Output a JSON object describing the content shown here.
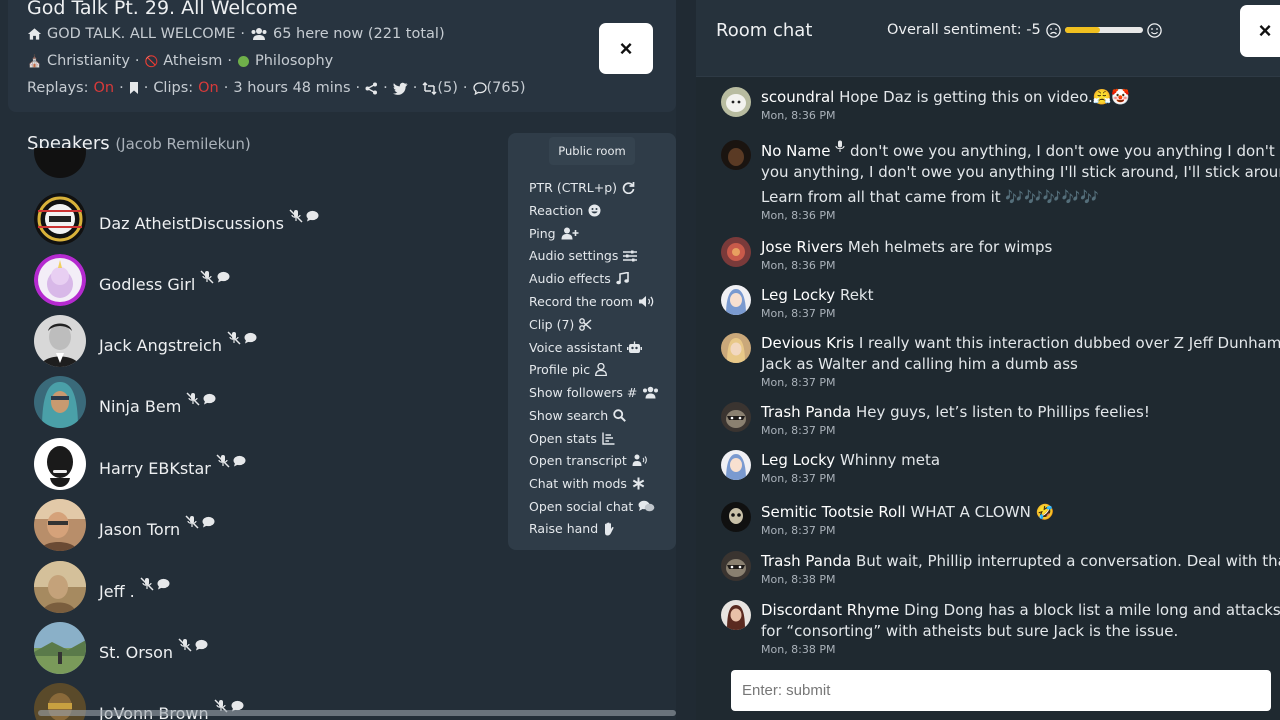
{
  "room": {
    "title": "God Talk Pt. 29. All Welcome",
    "subtitle": "GOD TALK. ALL WELCOME",
    "listeners": "65 here now (221 total)",
    "topics": [
      "Christianity",
      "Atheism",
      "Philosophy"
    ],
    "replays_label": "Replays:",
    "replays_value": "On",
    "clips_label": "Clips:",
    "clips_value": "On",
    "duration": "3 hours 48 mins",
    "reposts": "(5)",
    "comments": "(765)",
    "close_label": "×"
  },
  "speakers": {
    "title": "Speakers",
    "host": "(Jacob Remilekun)",
    "list": [
      {
        "name": "Daz AtheistDiscussions",
        "avatar": "atheist-logo-avatar"
      },
      {
        "name": "Godless Girl",
        "avatar": "unicorn-avatar"
      },
      {
        "name": "Jack Angstreich",
        "avatar": "portrait-avatar"
      },
      {
        "name": "Ninja Bem",
        "avatar": "hooded-avatar"
      },
      {
        "name": "Harry EBKstar",
        "avatar": "dark-face-avatar"
      },
      {
        "name": "Jason Torn",
        "avatar": "outdoor-avatar"
      },
      {
        "name": "Jeff .",
        "avatar": "sepia-avatar"
      },
      {
        "name": "St. Orson",
        "avatar": "landscape-avatar"
      },
      {
        "name": "JoVonn Brown",
        "avatar": "jovonn-avatar"
      }
    ]
  },
  "menu": {
    "public_room": "Public room",
    "items": [
      {
        "label": "PTR (CTRL+p)",
        "icon": "refresh-icon"
      },
      {
        "label": "Reaction",
        "icon": "smile-icon"
      },
      {
        "label": "Ping",
        "icon": "user-plus-icon"
      },
      {
        "label": "Audio settings",
        "icon": "sliders-icon"
      },
      {
        "label": "Audio effects",
        "icon": "music-icon"
      },
      {
        "label": "Record the room",
        "icon": "volume-icon"
      },
      {
        "label": "Clip (7)",
        "icon": "scissors-icon"
      },
      {
        "label": "Voice assistant",
        "icon": "robot-icon"
      },
      {
        "label": "Profile pic",
        "icon": "user-icon"
      },
      {
        "label": "Show followers #",
        "icon": "users-icon"
      },
      {
        "label": "Show search",
        "icon": "search-icon"
      },
      {
        "label": "Open stats",
        "icon": "stats-icon"
      },
      {
        "label": "Open transcript",
        "icon": "transcript-icon"
      },
      {
        "label": "Chat with mods",
        "icon": "asterisk-icon"
      },
      {
        "label": "Open social chat",
        "icon": "comments-icon"
      },
      {
        "label": "Raise hand",
        "icon": "hand-icon"
      }
    ]
  },
  "chat": {
    "title": "Room chat",
    "sentiment_label": "Overall sentiment: -5",
    "sentiment_level": 0.45,
    "close_label": "×",
    "input_placeholder": "Enter: submit",
    "messages": [
      {
        "user": "scoundral",
        "lines": [
          "Hope Daz is getting this on video.😤🤡"
        ],
        "time": "Mon, 8:36 PM",
        "avatar": "sheep-avatar"
      },
      {
        "user": "No Name",
        "mic": true,
        "lines": [
          "don't owe you anything, I don't owe you anything I don't owe",
          "you anything, I don't owe you anything I'll stick around, I'll stick around",
          "Learn from all that came from it 🎶🎶🎶🎶🎶"
        ],
        "time": "Mon, 8:36 PM",
        "avatar": "dark-avatar"
      },
      {
        "user": "Jose Rivers",
        "lines": [
          "Meh helmets are for wimps"
        ],
        "time": "Mon, 8:36 PM",
        "avatar": "flower-avatar"
      },
      {
        "user": "Leg Locky",
        "lines": [
          "Rekt"
        ],
        "time": "Mon, 8:37 PM",
        "avatar": "anime-avatar"
      },
      {
        "user": "Devious Kris",
        "lines": [
          "I really want this interaction dubbed over Z Jeff Dunham. W",
          "Jack as Walter and calling him a dumb ass"
        ],
        "time": "Mon, 8:37 PM",
        "avatar": "blond-avatar"
      },
      {
        "user": "Trash Panda",
        "lines": [
          "Hey guys, let’s listen to Phillips feelies!"
        ],
        "time": "Mon, 8:37 PM",
        "avatar": "raccoon-avatar"
      },
      {
        "user": "Leg Locky",
        "lines": [
          "Whinny meta"
        ],
        "time": "Mon, 8:37 PM",
        "avatar": "anime-avatar"
      },
      {
        "user": "Semitic Tootsie Roll",
        "lines": [
          "WHAT A CLOWN 🤣"
        ],
        "time": "Mon, 8:37 PM",
        "avatar": "skull-avatar"
      },
      {
        "user": "Trash Panda",
        "lines": [
          "But wait, Phillip interrupted a conversation. Deal with that t"
        ],
        "time": "Mon, 8:38 PM",
        "avatar": "raccoon-avatar"
      },
      {
        "user": "Discordant Rhyme",
        "lines": [
          "Ding Dong has a block list a mile long and attacks alli",
          "for “consorting” with atheists but sure Jack is the issue."
        ],
        "time": "Mon, 8:38 PM",
        "avatar": "woman-avatar"
      }
    ]
  },
  "colors": {
    "accent_red": "#d83a3a",
    "sentiment_fill": "#f0c020"
  }
}
